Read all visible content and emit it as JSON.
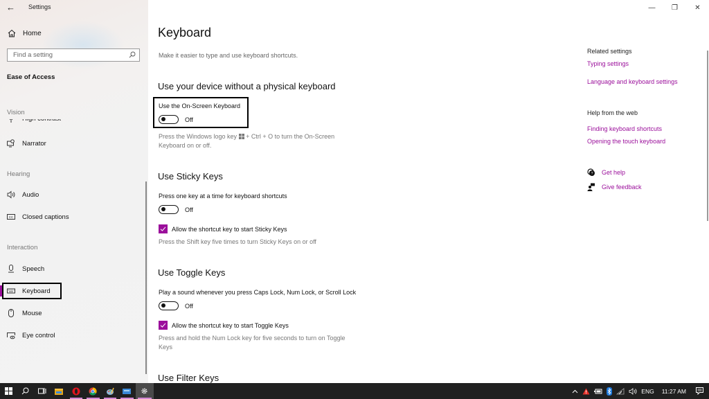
{
  "window": {
    "app_title": "Settings",
    "back_icon": "back-arrow-icon",
    "controls": {
      "minimize": "—",
      "maximize": "❐",
      "close": "✕"
    }
  },
  "sidebar": {
    "home_label": "Home",
    "search_placeholder": "Find a setting",
    "section_title": "Ease of Access",
    "groups": [
      {
        "label": "Vision"
      },
      {
        "label": "Hearing"
      },
      {
        "label": "Interaction"
      }
    ],
    "items": [
      {
        "label": "High contrast",
        "icon": "high-contrast-icon",
        "partially_visible": true
      },
      {
        "label": "Narrator",
        "icon": "narrator-icon"
      },
      {
        "label": "Audio",
        "icon": "audio-icon"
      },
      {
        "label": "Closed captions",
        "icon": "closed-captions-icon"
      },
      {
        "label": "Speech",
        "icon": "microphone-icon"
      },
      {
        "label": "Keyboard",
        "icon": "keyboard-icon",
        "selected": true
      },
      {
        "label": "Mouse",
        "icon": "mouse-icon"
      },
      {
        "label": "Eye control",
        "icon": "eye-control-icon"
      }
    ]
  },
  "main": {
    "title": "Keyboard",
    "description": "Make it easier to type and use keyboard shortcuts.",
    "sections": [
      {
        "heading": "Use your device without a physical keyboard",
        "toggle_label": "Use the On-Screen Keyboard",
        "toggle_state": "Off",
        "toggle_on": false,
        "helper_before": "Press the Windows logo key ",
        "helper_after": " + Ctrl + O to turn the On-Screen Keyboard on or off."
      },
      {
        "heading": "Use Sticky Keys",
        "toggle_label": "Press one key at a time for keyboard shortcuts",
        "toggle_state": "Off",
        "toggle_on": false,
        "checkbox_label": "Allow the shortcut key to start Sticky Keys",
        "checkbox_checked": true,
        "helper": "Press the Shift key five times to turn Sticky Keys on or off"
      },
      {
        "heading": "Use Toggle Keys",
        "toggle_label": "Play a sound whenever you press Caps Lock, Num Lock, or Scroll Lock",
        "toggle_state": "Off",
        "toggle_on": false,
        "checkbox_label": "Allow the shortcut key to start Toggle Keys",
        "checkbox_checked": true,
        "helper": "Press and hold the Num Lock key for five seconds to turn on Toggle Keys"
      },
      {
        "heading": "Use Filter Keys"
      }
    ]
  },
  "related": {
    "related_heading": "Related settings",
    "related_links": [
      "Typing settings",
      "Language and keyboard settings"
    ],
    "help_heading": "Help from the web",
    "help_links": [
      "Finding keyboard shortcuts",
      "Opening the touch keyboard"
    ],
    "get_help": "Get help",
    "give_feedback": "Give feedback"
  },
  "taskbar": {
    "apps": [
      {
        "name": "start",
        "icon": "windows-start-icon"
      },
      {
        "name": "search",
        "icon": "search-icon"
      },
      {
        "name": "task-view",
        "icon": "task-view-icon"
      },
      {
        "name": "file-explorer",
        "icon": "folder-icon"
      },
      {
        "name": "opera",
        "icon": "opera-icon",
        "running": true
      },
      {
        "name": "chrome",
        "icon": "chrome-icon",
        "running": true
      },
      {
        "name": "paint",
        "icon": "paint-icon",
        "running": true
      },
      {
        "name": "app",
        "icon": "window-app-icon",
        "running": true
      },
      {
        "name": "settings",
        "icon": "gear-icon",
        "running": true,
        "active": true
      }
    ],
    "tray": {
      "language": "ENG",
      "time": "11:27 AM"
    }
  },
  "colors": {
    "accent": "#9b0f9b",
    "taskbar": "#202020"
  }
}
